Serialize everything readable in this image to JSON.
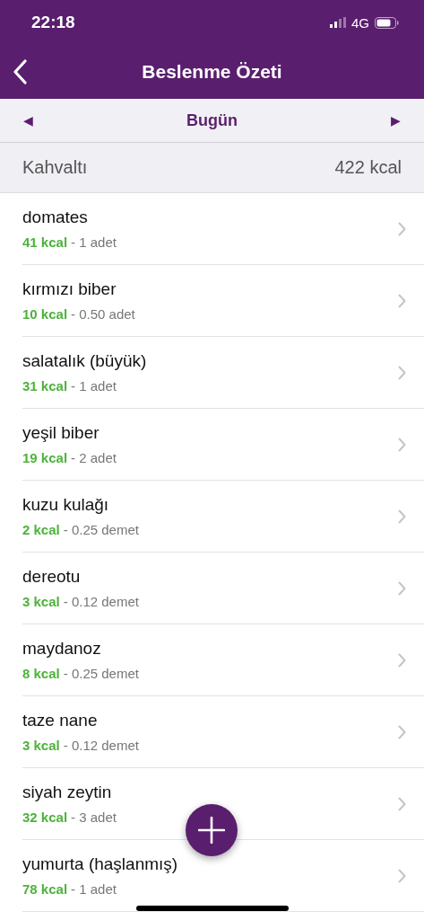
{
  "status_bar": {
    "time": "22:18",
    "network": "4G"
  },
  "nav_bar": {
    "title": "Beslenme Özeti"
  },
  "date_bar": {
    "label": "Bugün",
    "prev": "◀",
    "next": "▶"
  },
  "section": {
    "title": "Kahvaltı",
    "total": "422 kcal"
  },
  "items": [
    {
      "name": "domates",
      "kcal": "41 kcal",
      "amount": "- 1 adet"
    },
    {
      "name": "kırmızı biber",
      "kcal": "10 kcal",
      "amount": "- 0.50 adet"
    },
    {
      "name": "salatalık (büyük)",
      "kcal": "31 kcal",
      "amount": "- 1 adet"
    },
    {
      "name": "yeşil biber",
      "kcal": "19 kcal",
      "amount": "- 2 adet"
    },
    {
      "name": "kuzu kulağı",
      "kcal": "2 kcal",
      "amount": "- 0.25 demet"
    },
    {
      "name": "dereotu",
      "kcal": "3 kcal",
      "amount": "- 0.12 demet"
    },
    {
      "name": "maydanoz",
      "kcal": "8 kcal",
      "amount": "- 0.25 demet"
    },
    {
      "name": "taze nane",
      "kcal": "3 kcal",
      "amount": "- 0.12 demet"
    },
    {
      "name": "siyah zeytin",
      "kcal": "32 kcal",
      "amount": "- 3 adet"
    },
    {
      "name": "yumurta (haşlanmış)",
      "kcal": "78 kcal",
      "amount": "- 1 adet"
    }
  ]
}
